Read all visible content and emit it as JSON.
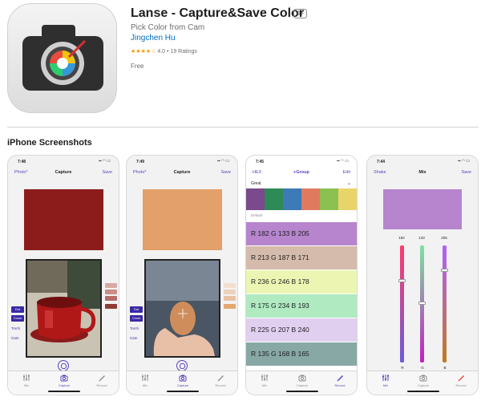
{
  "app": {
    "title": "Lanse - Capture&Save Color",
    "age_rating": "4+",
    "subtitle": "Pick Color from Cam",
    "developer": "Jingchen Hu",
    "rating_stars": "★★★★☆",
    "rating_value": "4.0",
    "rating_count": "19 Ratings",
    "price": "Free"
  },
  "section_title": "iPhone Screenshots",
  "tabs": [
    {
      "label": "Mix",
      "icon": "sliders-icon"
    },
    {
      "label": "Capture",
      "icon": "camera-icon"
    },
    {
      "label": "Record",
      "icon": "pencil-icon"
    }
  ],
  "screenshots": [
    {
      "time": "7:48",
      "nav_left": "Photo*",
      "nav_title": "Capture",
      "nav_right": "Save",
      "swatch_color": "#8c1c1c",
      "side_buttons": [
        "Dot",
        "Cross"
      ],
      "side_texts": [
        "Torch",
        "Cam"
      ],
      "mini_swatches": [
        "#d9a8a3",
        "#c98e86",
        "#b56d66",
        "#8c3e36"
      ],
      "active_tab": 1
    },
    {
      "time": "7:49",
      "nav_left": "Photo*",
      "nav_title": "Capture",
      "nav_right": "Save",
      "swatch_color": "#e3a06a",
      "side_buttons": [
        "Dot",
        "Cross"
      ],
      "side_texts": [
        "Torch",
        "Cam"
      ],
      "mini_swatches": [
        "#f3dfd0",
        "#eed1bb",
        "#e8c2a3",
        "#e3a86f"
      ],
      "active_tab": 1
    },
    {
      "time": "7:45",
      "nav_left": "HEX",
      "nav_title": "+Group",
      "nav_right": "Edit",
      "group_name": "Great",
      "palette": [
        "#7a4a8c",
        "#2e8b57",
        "#3d7ab8",
        "#e07a5f",
        "#8cc152",
        "#e8d46a"
      ],
      "default_label": "Default",
      "rows": [
        {
          "text": "R 182  G 133  B 205",
          "color": "#b685cd"
        },
        {
          "text": "R 213  G 187  B 171",
          "color": "#d5bbab"
        },
        {
          "text": "R 236  G 246  B 178",
          "color": "#ecf6b2"
        },
        {
          "text": "R 175  G 234  B 193",
          "color": "#afeac1"
        },
        {
          "text": "R 225  G 207  B 240",
          "color": "#e1cff0"
        },
        {
          "text": "R 135  G 168  B 165",
          "color": "#87a8a5"
        }
      ],
      "active_tab": 2
    },
    {
      "time": "7:44",
      "nav_left": "Shake",
      "nav_title": "Mix",
      "nav_right": "Save",
      "swatch_color": "#b685cd",
      "values": [
        "182",
        "133",
        "205"
      ],
      "value_fractions": [
        0.714,
        0.522,
        0.804
      ],
      "letters": [
        "R",
        "G",
        "B"
      ],
      "active_tab": 0
    }
  ],
  "colors": {
    "accent": "#5b3fc0",
    "link": "#0070c9",
    "star": "#ff9500",
    "icon_dark": "#2b2b2b"
  }
}
